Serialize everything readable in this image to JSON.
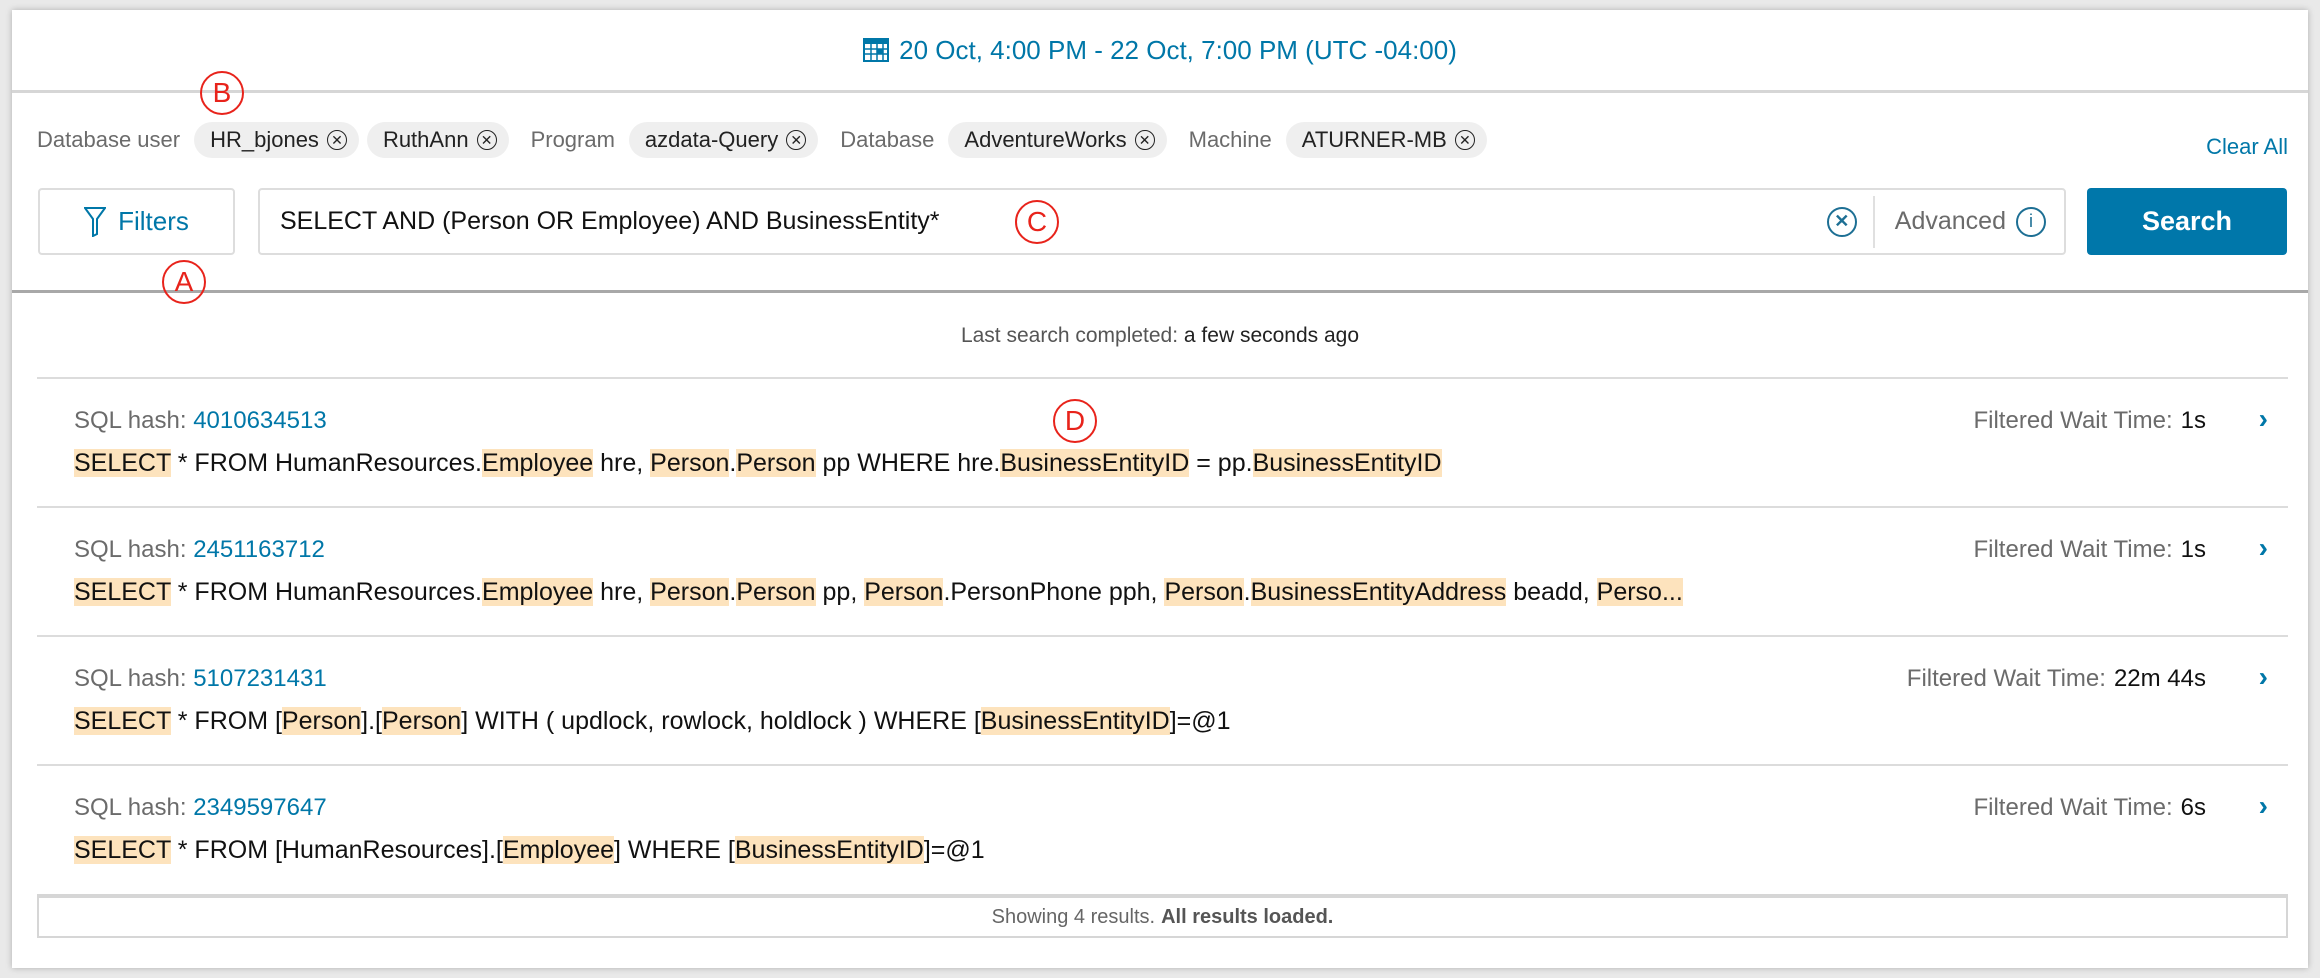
{
  "header": {
    "date_range": "20 Oct, 4:00 PM - 22 Oct, 7:00 PM (UTC -04:00)",
    "icon": "calendar-icon"
  },
  "filters": {
    "groups": [
      {
        "label": "Database user",
        "chips": [
          "HR_bjones",
          "RuthAnn"
        ]
      },
      {
        "label": "Program",
        "chips": [
          "azdata-Query"
        ]
      },
      {
        "label": "Database",
        "chips": [
          "AdventureWorks"
        ]
      },
      {
        "label": "Machine",
        "chips": [
          "ATURNER-MB"
        ]
      }
    ],
    "clear_all": "Clear All"
  },
  "toolbar": {
    "filters_label": "Filters",
    "query": "SELECT AND (Person OR Employee) AND BusinessEntity*",
    "advanced_label": "Advanced",
    "search_label": "Search"
  },
  "status": {
    "prefix": "Last search completed:",
    "value": "a few seconds ago"
  },
  "results": [
    {
      "hash_label": "SQL hash:",
      "hash": "4010634513",
      "wait_label": "Filtered Wait Time:",
      "wait": "1s",
      "sql": [
        [
          "SELECT",
          1
        ],
        [
          " * FROM HumanResources.",
          0
        ],
        [
          "Employee",
          1
        ],
        [
          " hre, ",
          0
        ],
        [
          "Person",
          1
        ],
        [
          ".",
          0
        ],
        [
          "Person",
          1
        ],
        [
          " pp WHERE hre.",
          0
        ],
        [
          "BusinessEntityID",
          1
        ],
        [
          " = pp.",
          0
        ],
        [
          "BusinessEntityID",
          1
        ]
      ]
    },
    {
      "hash_label": "SQL hash:",
      "hash": "2451163712",
      "wait_label": "Filtered Wait Time:",
      "wait": "1s",
      "sql": [
        [
          "SELECT",
          1
        ],
        [
          " * FROM HumanResources.",
          0
        ],
        [
          "Employee",
          1
        ],
        [
          " hre, ",
          0
        ],
        [
          "Person",
          1
        ],
        [
          ".",
          0
        ],
        [
          "Person",
          1
        ],
        [
          " pp, ",
          0
        ],
        [
          "Person",
          1
        ],
        [
          ".PersonPhone pph, ",
          0
        ],
        [
          "Person",
          1
        ],
        [
          ".",
          0
        ],
        [
          "BusinessEntityAddress",
          1
        ],
        [
          " beadd, ",
          0
        ],
        [
          "Perso...",
          1
        ]
      ]
    },
    {
      "hash_label": "SQL hash:",
      "hash": "5107231431",
      "wait_label": "Filtered Wait Time:",
      "wait": "22m 44s",
      "sql": [
        [
          "SELECT",
          1
        ],
        [
          " * FROM [",
          0
        ],
        [
          "Person",
          1
        ],
        [
          "].[",
          0
        ],
        [
          "Person",
          1
        ],
        [
          "] WITH ( updlock, rowlock, holdlock ) WHERE [",
          0
        ],
        [
          "BusinessEntityID",
          1
        ],
        [
          "]=@1",
          0
        ]
      ]
    },
    {
      "hash_label": "SQL hash:",
      "hash": "2349597647",
      "wait_label": "Filtered Wait Time:",
      "wait": "6s",
      "sql": [
        [
          "SELECT",
          1
        ],
        [
          " * FROM [HumanResources].[",
          0
        ],
        [
          "Employee",
          1
        ],
        [
          "] WHERE [",
          0
        ],
        [
          "BusinessEntityID",
          1
        ],
        [
          "]=@1",
          0
        ]
      ]
    }
  ],
  "footer": {
    "count_text": "Showing 4 results.",
    "loaded_text": "All results loaded."
  },
  "annotations": {
    "a": "A",
    "b": "B",
    "c": "C",
    "d": "D"
  },
  "colors": {
    "accent": "#0077a8",
    "search_button": "#0077aa",
    "highlight": "#fde3bd",
    "annotation": "#e8231b"
  }
}
